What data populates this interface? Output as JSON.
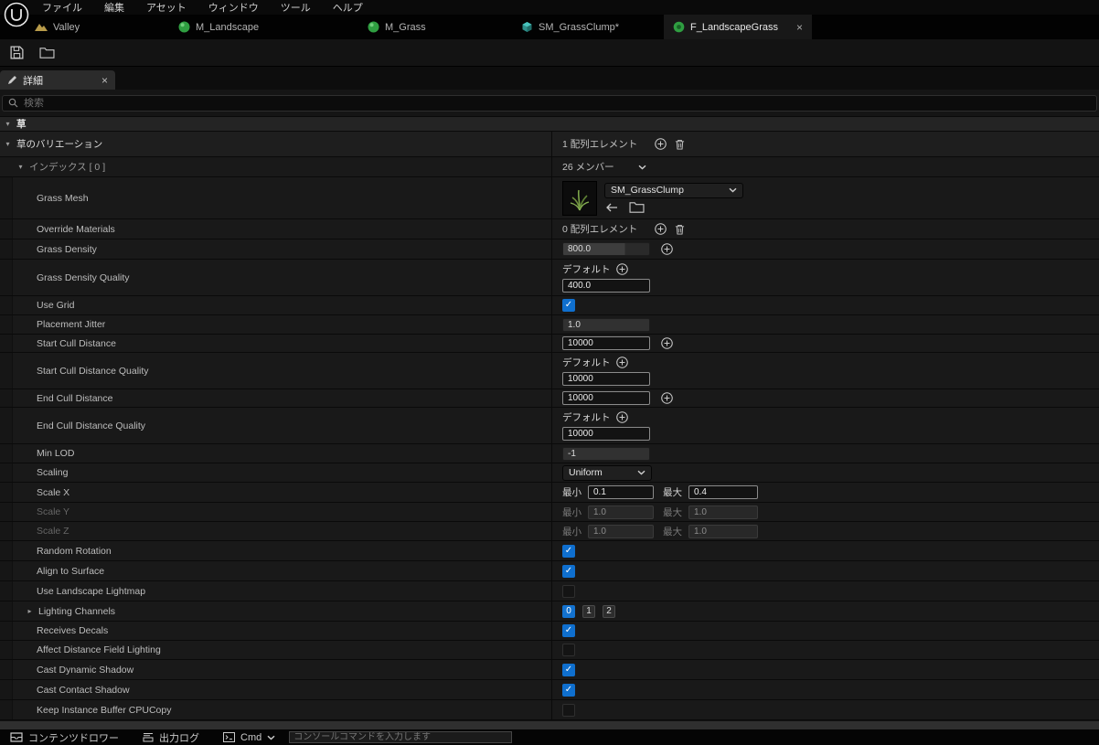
{
  "menu_bar": {
    "items": [
      "ファイル",
      "編集",
      "アセット",
      "ウィンドウ",
      "ツール",
      "ヘルプ"
    ]
  },
  "asset_tabs": {
    "close": "×",
    "tabs": [
      {
        "label": "Valley"
      },
      {
        "label": "M_Landscape"
      },
      {
        "label": "M_Grass"
      },
      {
        "label": "SM_GrassClump*"
      },
      {
        "label": "F_LandscapeGrass"
      }
    ]
  },
  "details_panel": {
    "tab_label": "詳細",
    "close": "×",
    "search_placeholder": "検索",
    "category": "草",
    "array_row": {
      "label": "草のバリエーション",
      "value": "1 配列エレメント"
    },
    "index_row": {
      "label": "インデックス [ 0 ]",
      "value": "26 メンバー"
    }
  },
  "properties": [
    {
      "key": "grass_mesh",
      "label": "Grass Mesh",
      "type": "asset",
      "value": "SM_GrassClump"
    },
    {
      "key": "override_materials",
      "label": "Override Materials",
      "type": "array",
      "value": "0 配列エレメント"
    },
    {
      "key": "grass_density",
      "label": "Grass Density",
      "type": "spin_plus",
      "value": "800.0"
    },
    {
      "key": "grass_density_quality",
      "label": "Grass Density Quality",
      "type": "quality",
      "default_label": "デフォルト",
      "value": "400.0"
    },
    {
      "key": "use_grid",
      "label": "Use Grid",
      "type": "check",
      "checked": true
    },
    {
      "key": "placement_jitter",
      "label": "Placement Jitter",
      "type": "spin",
      "value": "1.0"
    },
    {
      "key": "start_cull_distance",
      "label": "Start Cull Distance",
      "type": "edit_plus",
      "value": "10000"
    },
    {
      "key": "start_cull_distance_quality",
      "label": "Start Cull Distance Quality",
      "type": "quality",
      "default_label": "デフォルト",
      "value": "10000"
    },
    {
      "key": "end_cull_distance",
      "label": "End Cull Distance",
      "type": "edit_plus",
      "value": "10000"
    },
    {
      "key": "end_cull_distance_quality",
      "label": "End Cull Distance Quality",
      "type": "quality",
      "default_label": "デフォルト",
      "value": "10000"
    },
    {
      "key": "min_lod",
      "label": "Min LOD",
      "type": "spin",
      "value": "-1"
    },
    {
      "key": "scaling",
      "label": "Scaling",
      "type": "dropdown",
      "value": "Uniform"
    },
    {
      "key": "scale_x",
      "label": "Scale X",
      "type": "minmax",
      "min_label": "最小",
      "max_label": "最大",
      "min": "0.1",
      "max": "0.4",
      "enabled": true
    },
    {
      "key": "scale_y",
      "label": "Scale Y",
      "type": "minmax",
      "min_label": "最小",
      "max_label": "最大",
      "min": "1.0",
      "max": "1.0",
      "enabled": false
    },
    {
      "key": "scale_z",
      "label": "Scale Z",
      "type": "minmax",
      "min_label": "最小",
      "max_label": "最大",
      "min": "1.0",
      "max": "1.0",
      "enabled": false
    },
    {
      "key": "random_rotation",
      "label": "Random Rotation",
      "type": "check",
      "checked": true
    },
    {
      "key": "align_to_surface",
      "label": "Align to Surface",
      "type": "check",
      "checked": true
    },
    {
      "key": "use_landscape_lightmap",
      "label": "Use Landscape Lightmap",
      "type": "check",
      "checked": false
    },
    {
      "key": "lighting_channels",
      "label": "Lighting Channels",
      "type": "channels",
      "channels": [
        "0",
        "1",
        "2"
      ],
      "active": 0
    },
    {
      "key": "receives_decals",
      "label": "Receives Decals",
      "type": "check",
      "checked": true
    },
    {
      "key": "affect_distance_field_lighting",
      "label": "Affect Distance Field Lighting",
      "type": "check",
      "checked": false
    },
    {
      "key": "cast_dynamic_shadow",
      "label": "Cast Dynamic Shadow",
      "type": "check",
      "checked": true
    },
    {
      "key": "cast_contact_shadow",
      "label": "Cast Contact Shadow",
      "type": "check",
      "checked": true
    },
    {
      "key": "keep_instance_buffer_cpucopy",
      "label": "Keep Instance Buffer CPUCopy",
      "type": "check",
      "checked": false
    }
  ],
  "status_bar": {
    "content_drawer": "コンテンツドロワー",
    "output_log": "出力ログ",
    "cmd": "Cmd",
    "console_placeholder": "コンソールコマンドを入力します"
  },
  "colors": {
    "accent_blue": "#0f6fce",
    "checkbox_blue": "#0f6fce",
    "material_green": "#2f9e41",
    "mesh_teal": "#49c4bd",
    "landscape_tan": "#b89b4a"
  }
}
